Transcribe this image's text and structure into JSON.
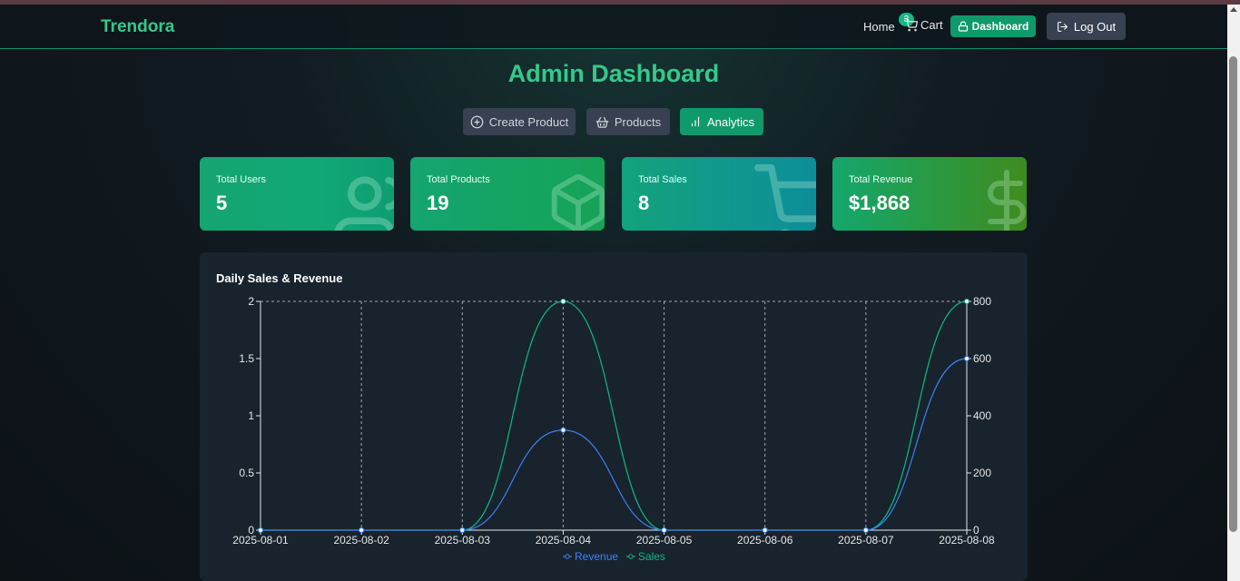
{
  "navbar": {
    "brand": "Trendora",
    "home": "Home",
    "cart": "Cart",
    "cart_count": "3",
    "dashboard": "Dashboard",
    "logout": "Log Out"
  },
  "page": {
    "title": "Admin Dashboard"
  },
  "tabs": [
    {
      "label": "Create Product",
      "icon": "plus-circle-icon"
    },
    {
      "label": "Products",
      "icon": "basket-icon"
    },
    {
      "label": "Analytics",
      "icon": "bar-chart-icon",
      "active": true
    }
  ],
  "stats": [
    {
      "label": "Total Users",
      "value": "5",
      "icon": "users-icon"
    },
    {
      "label": "Total Products",
      "value": "19",
      "icon": "package-icon"
    },
    {
      "label": "Total Sales",
      "value": "8",
      "icon": "cart-icon"
    },
    {
      "label": "Total Revenue",
      "value": "$1,868",
      "icon": "dollar-icon"
    }
  ],
  "colors": {
    "accent": "#34c98a",
    "revenue": "#3b82f6",
    "sales": "#10b981"
  },
  "chart_data": {
    "type": "line",
    "title": "Daily Sales & Revenue",
    "x": [
      "2025-08-01",
      "2025-08-02",
      "2025-08-03",
      "2025-08-04",
      "2025-08-05",
      "2025-08-06",
      "2025-08-07",
      "2025-08-08"
    ],
    "y_left_ticks": [
      "0",
      "0.5",
      "1",
      "1.5",
      "2"
    ],
    "y_right_ticks": [
      "0",
      "200",
      "400",
      "600",
      "800"
    ],
    "ylim_left": [
      0,
      2
    ],
    "ylim_right": [
      0,
      800
    ],
    "series": [
      {
        "name": "Sales",
        "axis": "left",
        "values": [
          0,
          0,
          0,
          2,
          0,
          0,
          0,
          2
        ],
        "color": "#10b981"
      },
      {
        "name": "Revenue",
        "axis": "right",
        "values": [
          0,
          0,
          0,
          350,
          0,
          0,
          0,
          600
        ],
        "color": "#3b82f6"
      }
    ],
    "legend": "bottom",
    "grid": true
  }
}
